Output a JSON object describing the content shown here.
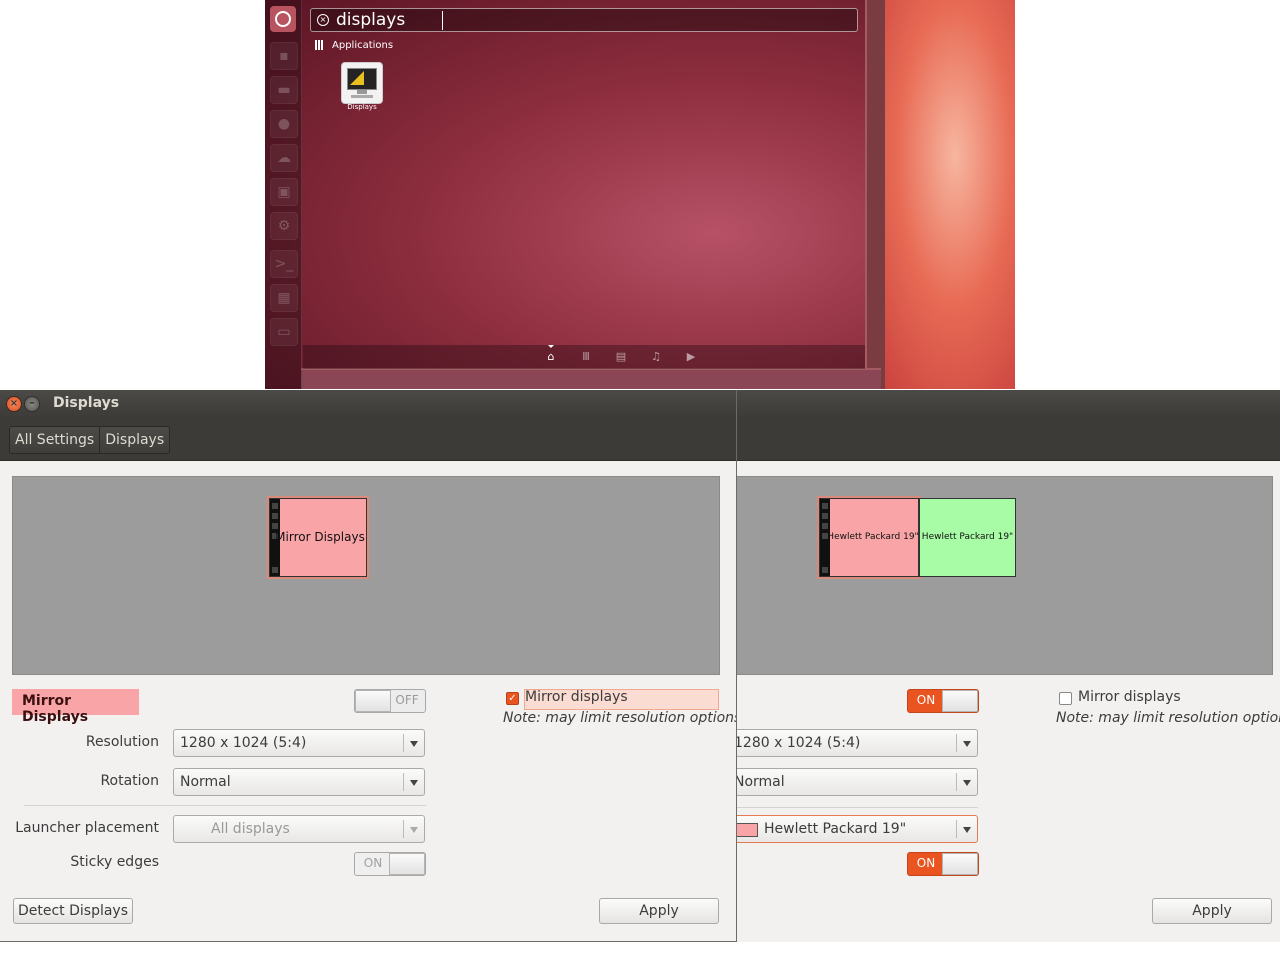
{
  "dash": {
    "search_query": "displays",
    "category": "Applications",
    "results": [
      {
        "label": "Displays",
        "icon": "displays-app-icon"
      }
    ],
    "launcher_icons": [
      "ubuntu-logo-icon",
      "home-folder-icon",
      "files-icon",
      "firefox-icon",
      "ubuntu-one-icon",
      "software-center-icon",
      "settings-icon",
      "terminal-icon",
      "workspaces-icon",
      "trash-icon"
    ],
    "lenses": [
      "home-lens-icon",
      "applications-lens-icon",
      "files-lens-icon",
      "music-lens-icon",
      "video-lens-icon"
    ]
  },
  "window": {
    "title": "Displays",
    "breadcrumbs": [
      "All Settings",
      "Displays"
    ]
  },
  "left_panel": {
    "preview_monitor_label": "Mirror Displays",
    "monitor_name": "Mirror Displays",
    "power_switch": "OFF",
    "mirror_checkbox": {
      "label": "Mirror displays",
      "checked": true
    },
    "note": "Note: may limit resolution options",
    "resolution_label": "Resolution",
    "resolution_value": "1280 x 1024 (5:4)",
    "rotation_label": "Rotation",
    "rotation_value": "Normal",
    "launcher_label": "Launcher placement",
    "launcher_value": "All displays",
    "sticky_label": "Sticky edges",
    "sticky_value": "ON",
    "detect_button": "Detect Displays",
    "apply_button": "Apply"
  },
  "right_panel": {
    "monitor_1_label": "Hewlett Packard 19\"",
    "monitor_2_label": "Hewlett Packard 19\"",
    "power_switch": "ON",
    "mirror_checkbox": {
      "label": "Mirror displays",
      "checked": false
    },
    "note": "Note: may limit resolution options",
    "resolution_value": "1280 x 1024 (5:4)",
    "rotation_value": "Normal",
    "launcher_value": "Hewlett Packard 19\"",
    "sticky_value": "ON",
    "apply_button": "Apply"
  },
  "colors": {
    "accent": "#e95420",
    "monitor_primary": "#f9a5a7",
    "monitor_secondary": "#a8fca6",
    "dash_background": "#8e2e3e"
  }
}
